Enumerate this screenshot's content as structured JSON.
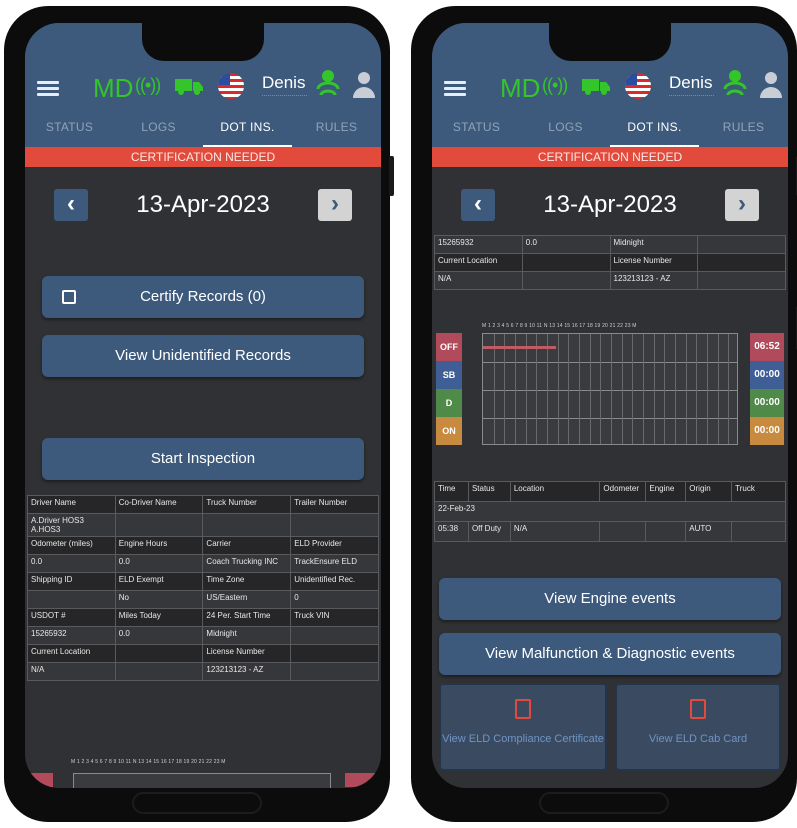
{
  "header": {
    "status_code": "MD",
    "user_name": "Denis",
    "tabs": [
      "STATUS",
      "LOGS",
      "DOT INS.",
      "RULES"
    ],
    "active_tab": "DOT INS.",
    "colors": {
      "bar": "#3d5a7c",
      "accent_green": "#34c52a",
      "alert": "#e24a3c"
    }
  },
  "banner": {
    "text": "CERTIFICATION NEEDED"
  },
  "date": {
    "value": "13-Apr-2023",
    "prev_icon": "chevron-left-icon",
    "next_icon": "chevron-right-icon"
  },
  "left": {
    "certify_label": "Certify Records (0)",
    "unidentified_label": "View Unidentified Records",
    "start_label": "Start Inspection",
    "table": [
      [
        "Driver Name",
        "Co-Driver Name",
        "Truck Number",
        "Trailer Number"
      ],
      [
        "A.Driver HOS3 A.HOS3",
        "",
        "",
        ""
      ],
      [
        "Odometer (miles)",
        "Engine Hours",
        "Carrier",
        "ELD Provider"
      ],
      [
        "0.0",
        "0.0",
        "Coach Trucking INC",
        "TrackEnsure ELD"
      ],
      [
        "Shipping ID",
        "ELD Exempt",
        "Time Zone",
        "Unidentified Rec."
      ],
      [
        "",
        "No",
        "US/Eastern",
        "0"
      ],
      [
        "USDOT #",
        "Miles Today",
        "24 Per. Start Time",
        "Truck VIN"
      ],
      [
        "15265932",
        "0.0",
        "Midnight",
        ""
      ],
      [
        "Current Location",
        "",
        "License Number",
        ""
      ],
      [
        "N/A",
        "",
        "123213123 - AZ",
        ""
      ]
    ],
    "hours_row": "M 1 2 3 4 5 6 7 8 9 10 11 N 13 14 15 16 17 18 19 20 21 22 23 M"
  },
  "right": {
    "table": [
      [
        "15265932",
        "0.0",
        "Midnight",
        ""
      ],
      [
        "Current Location",
        "",
        "License Number",
        ""
      ],
      [
        "N/A",
        "",
        "123213123 - AZ",
        ""
      ]
    ],
    "hours_row": "M 1 2 3 4 5 6 7 8 9 10 11 N 13 14 15 16 17 18 19 20 21 22 23 M",
    "statuses": [
      {
        "label": "OFF",
        "time": "06:52",
        "color": "#b14a5a"
      },
      {
        "label": "SB",
        "time": "00:00",
        "color": "#3f5e96"
      },
      {
        "label": "D",
        "time": "00:00",
        "color": "#4f8a49"
      },
      {
        "label": "ON",
        "time": "00:00",
        "color": "#c88a3e"
      }
    ],
    "events_header": [
      "Time",
      "Status",
      "Location",
      "Odometer",
      "Engine",
      "Origin",
      "Truck"
    ],
    "events_date": "22-Feb-23",
    "events_row": [
      "05:38",
      "Off Duty",
      "N/A",
      "",
      "",
      "AUTO",
      ""
    ],
    "engine_label": "View Engine events",
    "malfunction_label": "View Malfunction & Diagnostic events",
    "compliance_label": "View ELD Compliance Certificate",
    "cabcard_label": "View ELD Cab Card"
  }
}
